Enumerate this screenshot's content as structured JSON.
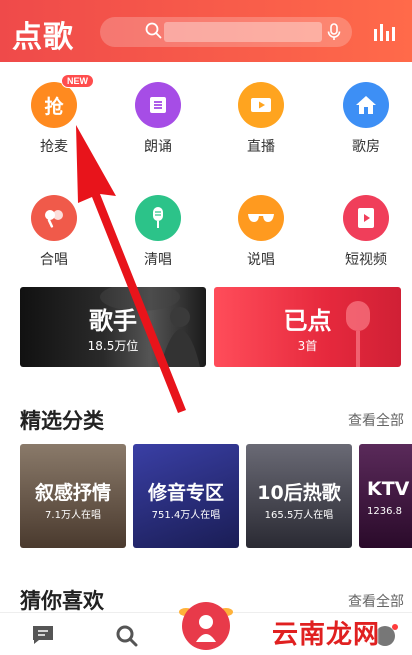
{
  "header": {
    "title": "点歌",
    "search_placeholder": ""
  },
  "grid": [
    {
      "label": "抢麦",
      "icon": "grab-mic-icon",
      "color": "#ff8a1f",
      "badge": "NEW",
      "glyph": "抢"
    },
    {
      "label": "朗诵",
      "icon": "recite-icon",
      "color": "#a64de6"
    },
    {
      "label": "直播",
      "icon": "live-icon",
      "color": "#ffa41f"
    },
    {
      "label": "歌房",
      "icon": "song-room-icon",
      "color": "#3d8ff5"
    },
    {
      "label": "合唱",
      "icon": "chorus-icon",
      "color": "#f05a4a"
    },
    {
      "label": "清唱",
      "icon": "acapella-icon",
      "color": "#2cc389"
    },
    {
      "label": "说唱",
      "icon": "rap-icon",
      "color": "#ff9a1f"
    },
    {
      "label": "短视频",
      "icon": "short-video-icon",
      "color": "#f03e5a"
    }
  ],
  "banners": {
    "singer": {
      "title": "歌手",
      "subtitle": "18.5万位"
    },
    "ordered": {
      "title": "已点",
      "subtitle": "3首"
    }
  },
  "featured": {
    "title": "精选分类",
    "link": "查看全部",
    "categories": [
      {
        "title": "叙感抒情",
        "subtitle": "7.1万人在唱",
        "color": "#6b5a4a"
      },
      {
        "title": "修音专区",
        "subtitle": "751.4万人在唱",
        "color": "#2a2f7a"
      },
      {
        "title": "10后热歌",
        "subtitle": "165.5万人在唱",
        "color": "#4a4a55"
      },
      {
        "title": "KTV",
        "subtitle": "1236.8",
        "color": "#3a1a3a"
      }
    ]
  },
  "guess": {
    "title": "猜你喜欢",
    "link": "查看全部"
  },
  "nav": {
    "items": [
      "message-icon",
      "search-icon",
      "sing-icon",
      "store-icon",
      "profile-icon"
    ]
  },
  "watermark": "云南龙网",
  "colors": {
    "header_start": "#ef4a4a",
    "header_end": "#ff6a4a",
    "arrow": "#e8141b"
  }
}
